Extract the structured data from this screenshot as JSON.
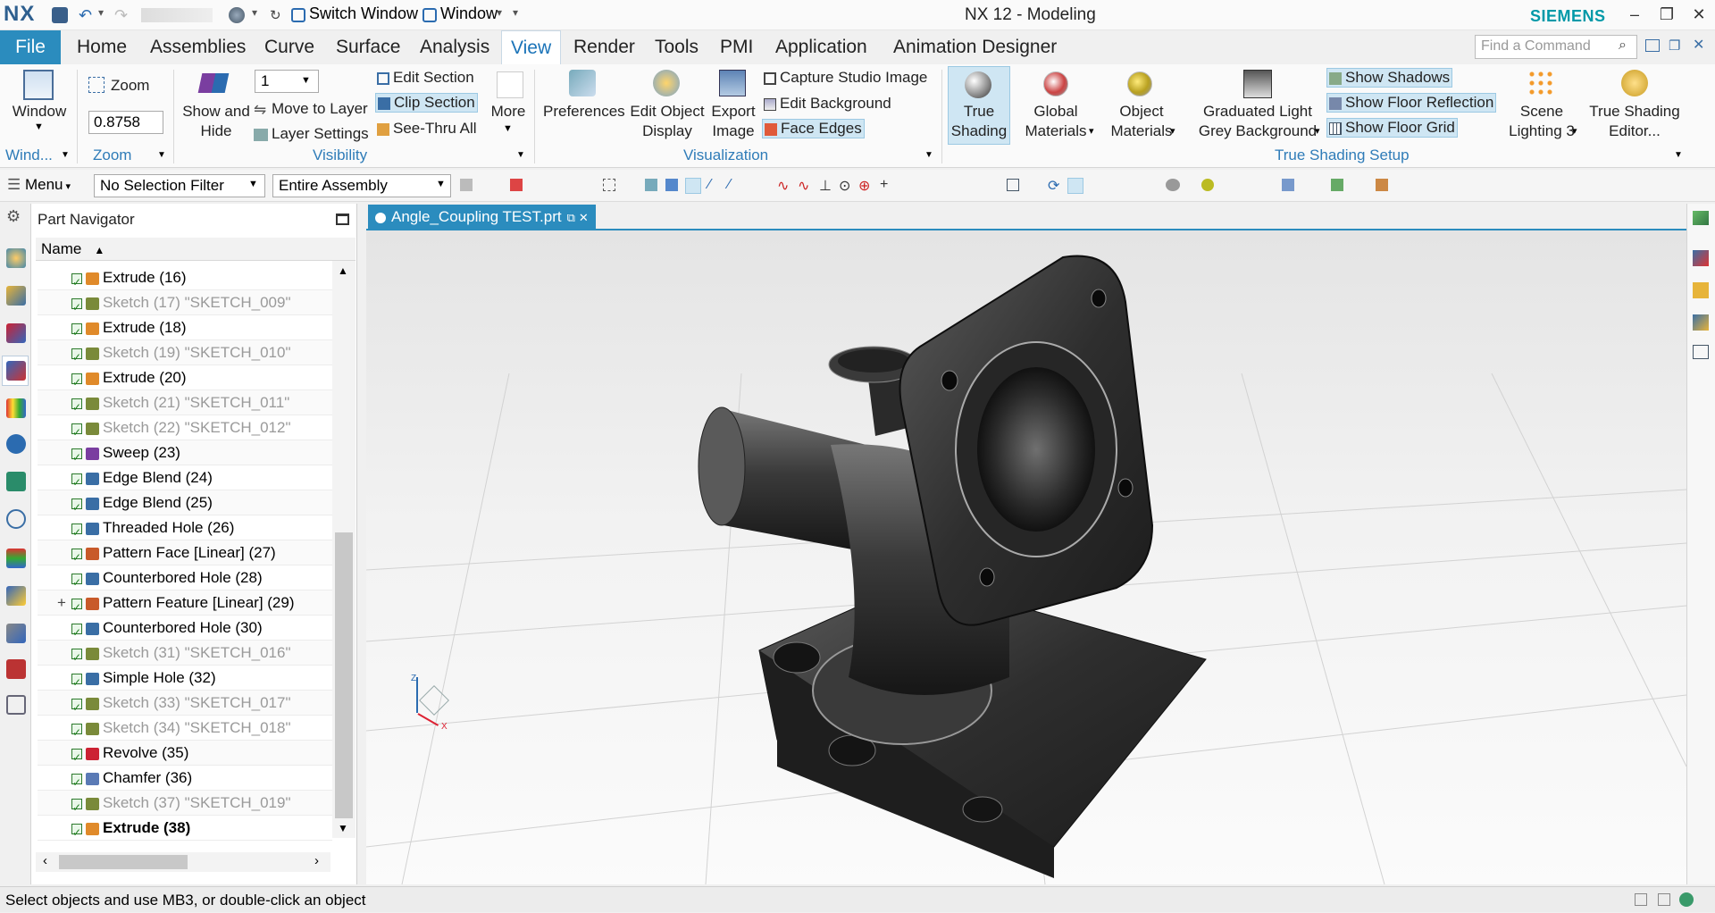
{
  "app": {
    "logo": "NX",
    "title": "NX 12 - Modeling",
    "brand": "SIEMENS"
  },
  "quick_access": {
    "switch_window": "Switch Window",
    "window": "Window"
  },
  "menu": {
    "file": "File",
    "tabs": [
      "Home",
      "Assemblies",
      "Curve",
      "Surface",
      "Analysis",
      "View",
      "Render",
      "Tools",
      "PMI",
      "Application",
      "Animation Designer"
    ],
    "search_placeholder": "Find a Command"
  },
  "ribbon": {
    "window": {
      "label": "Window",
      "group": "Wind..."
    },
    "zoom": {
      "label": "Zoom",
      "value": "0.8758",
      "group": "Zoom"
    },
    "visibility": {
      "show_hide": "Show and Hide",
      "layer_value": "1",
      "move_to_layer": "Move to Layer",
      "layer_settings": "Layer Settings",
      "edit_section": "Edit Section",
      "clip_section": "Clip Section",
      "see_thru_all": "See-Thru All",
      "more": "More",
      "group": "Visibility"
    },
    "visualization": {
      "preferences": "Preferences",
      "edit_object_display": "Edit Object Display",
      "export_image": "Export Image",
      "capture_studio_image": "Capture Studio Image",
      "edit_background": "Edit Background",
      "face_edges": "Face Edges",
      "group": "Visualization"
    },
    "true_shading": {
      "true_shading": "True Shading",
      "global_materials": "Global Materials",
      "object_materials": "Object Materials",
      "graduated_light": "Graduated Light Grey Background",
      "show_shadows": "Show Shadows",
      "show_floor_reflection": "Show Floor Reflection",
      "show_floor_grid": "Show Floor Grid",
      "scene_lighting": "Scene Lighting 3",
      "true_shading_editor": "True Shading Editor...",
      "group": "True Shading Setup"
    }
  },
  "toolbar": {
    "menu": "Menu",
    "selection_filter": "No Selection Filter",
    "assembly_scope": "Entire Assembly"
  },
  "navigator": {
    "title": "Part Navigator",
    "column_name": "Name",
    "rows": [
      {
        "label": "Extrude (16)",
        "type": "extrude",
        "dim": false,
        "bold": false,
        "expand": false
      },
      {
        "label": "Sketch (17) \"SKETCH_009\"",
        "type": "sketch",
        "dim": true,
        "bold": false,
        "expand": false
      },
      {
        "label": "Extrude (18)",
        "type": "extrude",
        "dim": false,
        "bold": false,
        "expand": false
      },
      {
        "label": "Sketch (19) \"SKETCH_010\"",
        "type": "sketch",
        "dim": true,
        "bold": false,
        "expand": false
      },
      {
        "label": "Extrude (20)",
        "type": "extrude",
        "dim": false,
        "bold": false,
        "expand": false
      },
      {
        "label": "Sketch (21) \"SKETCH_011\"",
        "type": "sketch",
        "dim": true,
        "bold": false,
        "expand": false
      },
      {
        "label": "Sketch (22) \"SKETCH_012\"",
        "type": "sketch",
        "dim": true,
        "bold": false,
        "expand": false
      },
      {
        "label": "Sweep (23)",
        "type": "sweep",
        "dim": false,
        "bold": false,
        "expand": false
      },
      {
        "label": "Edge Blend (24)",
        "type": "blend",
        "dim": false,
        "bold": false,
        "expand": false
      },
      {
        "label": "Edge Blend (25)",
        "type": "blend",
        "dim": false,
        "bold": false,
        "expand": false
      },
      {
        "label": "Threaded Hole (26)",
        "type": "hole",
        "dim": false,
        "bold": false,
        "expand": false
      },
      {
        "label": "Pattern Face [Linear] (27)",
        "type": "pattern",
        "dim": false,
        "bold": false,
        "expand": false
      },
      {
        "label": "Counterbored Hole (28)",
        "type": "hole",
        "dim": false,
        "bold": false,
        "expand": false
      },
      {
        "label": "Pattern Feature [Linear] (29)",
        "type": "pattern",
        "dim": false,
        "bold": false,
        "expand": true
      },
      {
        "label": "Counterbored Hole (30)",
        "type": "hole",
        "dim": false,
        "bold": false,
        "expand": false
      },
      {
        "label": "Sketch (31) \"SKETCH_016\"",
        "type": "sketch",
        "dim": true,
        "bold": false,
        "expand": false
      },
      {
        "label": "Simple Hole (32)",
        "type": "hole",
        "dim": false,
        "bold": false,
        "expand": false
      },
      {
        "label": "Sketch (33) \"SKETCH_017\"",
        "type": "sketch",
        "dim": true,
        "bold": false,
        "expand": false
      },
      {
        "label": "Sketch (34) \"SKETCH_018\"",
        "type": "sketch",
        "dim": true,
        "bold": false,
        "expand": false
      },
      {
        "label": "Revolve (35)",
        "type": "revolve",
        "dim": false,
        "bold": false,
        "expand": false
      },
      {
        "label": "Chamfer (36)",
        "type": "chamfer",
        "dim": false,
        "bold": false,
        "expand": false
      },
      {
        "label": "Sketch (37) \"SKETCH_019\"",
        "type": "sketch",
        "dim": true,
        "bold": false,
        "expand": false
      },
      {
        "label": "Extrude (38)",
        "type": "extrude",
        "dim": false,
        "bold": true,
        "expand": false
      }
    ]
  },
  "document": {
    "tab": "Angle_Coupling TEST.prt"
  },
  "triad": {
    "z": "Z",
    "x": "X"
  },
  "status": "Select objects and use MB3, or double-click an object",
  "colors": {
    "accent": "#2b8cbe",
    "siemens": "#0099a8",
    "highlight": "#cfe6f3"
  }
}
